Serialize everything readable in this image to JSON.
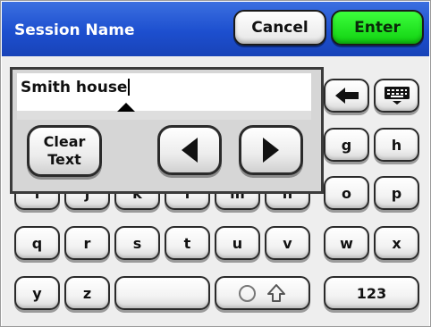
{
  "header": {
    "title": "Session Name",
    "cancel_label": "Cancel",
    "enter_label": "Enter"
  },
  "input": {
    "value": "Smith house"
  },
  "overlay": {
    "clear_label_line1": "Clear",
    "clear_label_line2": "Text"
  },
  "keys": {
    "row1": [
      "i",
      "j",
      "k",
      "l",
      "m",
      "n"
    ],
    "g": "g",
    "h": "h",
    "o": "o",
    "p": "p",
    "row3": [
      "q",
      "r",
      "s",
      "t",
      "u",
      "v",
      "w",
      "x"
    ],
    "y": "y",
    "z": "z",
    "numbers_label": "123"
  },
  "colors": {
    "header_blue": "#1d4fcf",
    "enter_green": "#22e022",
    "background": "#eeeeee"
  },
  "icons": [
    "backspace-icon",
    "keyboard-icon",
    "left-arrow-icon",
    "right-arrow-icon",
    "shift-icon"
  ]
}
